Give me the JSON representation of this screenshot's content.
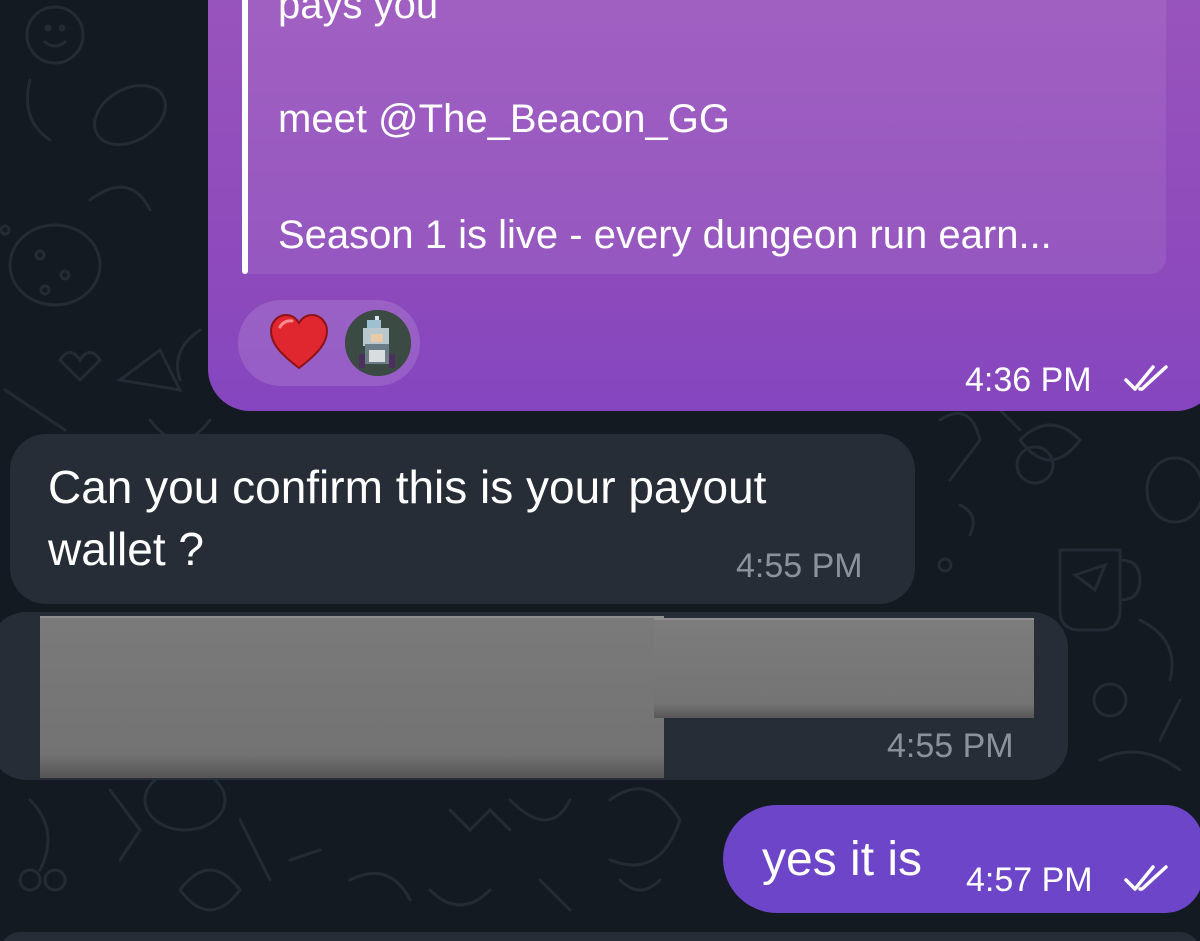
{
  "messages": {
    "forwarded": {
      "lines": [
        "pays you",
        "meet @The_Beacon_GG",
        "Season 1 is live - every dungeon run earn..."
      ],
      "reactions": [
        "heart",
        "character-avatar"
      ],
      "time": "4:36 PM"
    },
    "incoming_question": {
      "lines": [
        "Can you confirm this is your payout",
        "wallet ?"
      ],
      "time": "4:55 PM"
    },
    "incoming_image": {
      "time": "4:55 PM"
    },
    "reply": {
      "text": "yes it is",
      "time": "4:57 PM"
    }
  },
  "icons": {
    "read_receipt": "double-check-icon",
    "reaction_heart": "heart-icon"
  },
  "colors": {
    "background": "#141a22",
    "outgoing_bubble": "#9a55bd",
    "reply_bubble": "#6c45c8",
    "incoming_bubble": "#262d37",
    "redaction": "#767676",
    "heart": "#e0262e"
  }
}
